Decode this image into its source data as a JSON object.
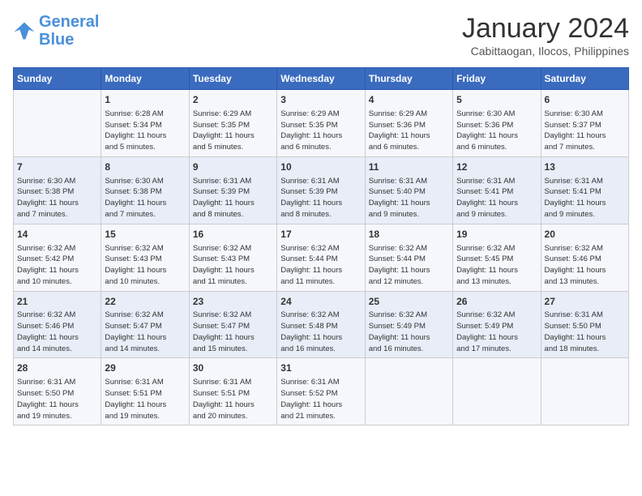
{
  "header": {
    "logo_line1": "General",
    "logo_line2": "Blue",
    "month_title": "January 2024",
    "subtitle": "Cabittaogan, Ilocos, Philippines"
  },
  "days_of_week": [
    "Sunday",
    "Monday",
    "Tuesday",
    "Wednesday",
    "Thursday",
    "Friday",
    "Saturday"
  ],
  "weeks": [
    [
      {
        "day": "",
        "content": ""
      },
      {
        "day": "1",
        "content": "Sunrise: 6:28 AM\nSunset: 5:34 PM\nDaylight: 11 hours\nand 5 minutes."
      },
      {
        "day": "2",
        "content": "Sunrise: 6:29 AM\nSunset: 5:35 PM\nDaylight: 11 hours\nand 5 minutes."
      },
      {
        "day": "3",
        "content": "Sunrise: 6:29 AM\nSunset: 5:35 PM\nDaylight: 11 hours\nand 6 minutes."
      },
      {
        "day": "4",
        "content": "Sunrise: 6:29 AM\nSunset: 5:36 PM\nDaylight: 11 hours\nand 6 minutes."
      },
      {
        "day": "5",
        "content": "Sunrise: 6:30 AM\nSunset: 5:36 PM\nDaylight: 11 hours\nand 6 minutes."
      },
      {
        "day": "6",
        "content": "Sunrise: 6:30 AM\nSunset: 5:37 PM\nDaylight: 11 hours\nand 7 minutes."
      }
    ],
    [
      {
        "day": "7",
        "content": "Sunrise: 6:30 AM\nSunset: 5:38 PM\nDaylight: 11 hours\nand 7 minutes."
      },
      {
        "day": "8",
        "content": "Sunrise: 6:30 AM\nSunset: 5:38 PM\nDaylight: 11 hours\nand 7 minutes."
      },
      {
        "day": "9",
        "content": "Sunrise: 6:31 AM\nSunset: 5:39 PM\nDaylight: 11 hours\nand 8 minutes."
      },
      {
        "day": "10",
        "content": "Sunrise: 6:31 AM\nSunset: 5:39 PM\nDaylight: 11 hours\nand 8 minutes."
      },
      {
        "day": "11",
        "content": "Sunrise: 6:31 AM\nSunset: 5:40 PM\nDaylight: 11 hours\nand 9 minutes."
      },
      {
        "day": "12",
        "content": "Sunrise: 6:31 AM\nSunset: 5:41 PM\nDaylight: 11 hours\nand 9 minutes."
      },
      {
        "day": "13",
        "content": "Sunrise: 6:31 AM\nSunset: 5:41 PM\nDaylight: 11 hours\nand 9 minutes."
      }
    ],
    [
      {
        "day": "14",
        "content": "Sunrise: 6:32 AM\nSunset: 5:42 PM\nDaylight: 11 hours\nand 10 minutes."
      },
      {
        "day": "15",
        "content": "Sunrise: 6:32 AM\nSunset: 5:43 PM\nDaylight: 11 hours\nand 10 minutes."
      },
      {
        "day": "16",
        "content": "Sunrise: 6:32 AM\nSunset: 5:43 PM\nDaylight: 11 hours\nand 11 minutes."
      },
      {
        "day": "17",
        "content": "Sunrise: 6:32 AM\nSunset: 5:44 PM\nDaylight: 11 hours\nand 11 minutes."
      },
      {
        "day": "18",
        "content": "Sunrise: 6:32 AM\nSunset: 5:44 PM\nDaylight: 11 hours\nand 12 minutes."
      },
      {
        "day": "19",
        "content": "Sunrise: 6:32 AM\nSunset: 5:45 PM\nDaylight: 11 hours\nand 13 minutes."
      },
      {
        "day": "20",
        "content": "Sunrise: 6:32 AM\nSunset: 5:46 PM\nDaylight: 11 hours\nand 13 minutes."
      }
    ],
    [
      {
        "day": "21",
        "content": "Sunrise: 6:32 AM\nSunset: 5:46 PM\nDaylight: 11 hours\nand 14 minutes."
      },
      {
        "day": "22",
        "content": "Sunrise: 6:32 AM\nSunset: 5:47 PM\nDaylight: 11 hours\nand 14 minutes."
      },
      {
        "day": "23",
        "content": "Sunrise: 6:32 AM\nSunset: 5:47 PM\nDaylight: 11 hours\nand 15 minutes."
      },
      {
        "day": "24",
        "content": "Sunrise: 6:32 AM\nSunset: 5:48 PM\nDaylight: 11 hours\nand 16 minutes."
      },
      {
        "day": "25",
        "content": "Sunrise: 6:32 AM\nSunset: 5:49 PM\nDaylight: 11 hours\nand 16 minutes."
      },
      {
        "day": "26",
        "content": "Sunrise: 6:32 AM\nSunset: 5:49 PM\nDaylight: 11 hours\nand 17 minutes."
      },
      {
        "day": "27",
        "content": "Sunrise: 6:31 AM\nSunset: 5:50 PM\nDaylight: 11 hours\nand 18 minutes."
      }
    ],
    [
      {
        "day": "28",
        "content": "Sunrise: 6:31 AM\nSunset: 5:50 PM\nDaylight: 11 hours\nand 19 minutes."
      },
      {
        "day": "29",
        "content": "Sunrise: 6:31 AM\nSunset: 5:51 PM\nDaylight: 11 hours\nand 19 minutes."
      },
      {
        "day": "30",
        "content": "Sunrise: 6:31 AM\nSunset: 5:51 PM\nDaylight: 11 hours\nand 20 minutes."
      },
      {
        "day": "31",
        "content": "Sunrise: 6:31 AM\nSunset: 5:52 PM\nDaylight: 11 hours\nand 21 minutes."
      },
      {
        "day": "",
        "content": ""
      },
      {
        "day": "",
        "content": ""
      },
      {
        "day": "",
        "content": ""
      }
    ]
  ]
}
